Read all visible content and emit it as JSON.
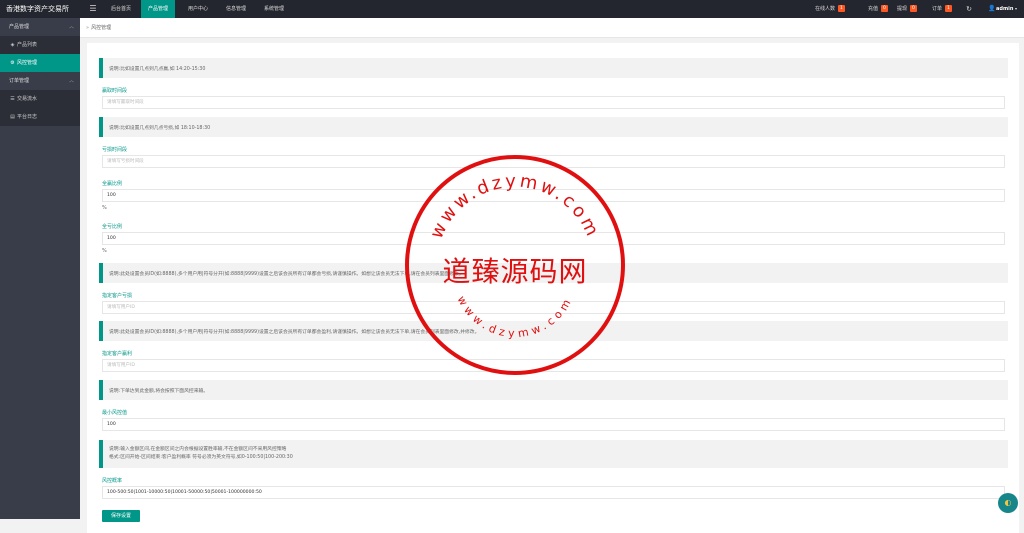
{
  "app": {
    "title": "香港数字资产交易所"
  },
  "topnav": [
    "后台首页",
    "产品管理",
    "用户中心",
    "信息管理",
    "系统管理"
  ],
  "status": [
    {
      "label": "在线人数",
      "count": "1"
    },
    {
      "label": "充值",
      "count": "0"
    },
    {
      "label": "提现",
      "count": "0"
    },
    {
      "label": "订单",
      "count": "1"
    }
  ],
  "user": {
    "name": "admin"
  },
  "sidebar": {
    "group1": "产品管理",
    "group1_items": [
      "产品列表",
      "风控管理"
    ],
    "group2": "订单管理",
    "group2_items": [
      "交易流水",
      "平台日志"
    ]
  },
  "breadcrumb": "风控管理",
  "form": {
    "note1": "说明:比如设置几点到几点赢,如 14:20-15:30",
    "label1": "赢取时间段",
    "placeholder1": "请填写赢取时间段",
    "note2": "说明:比如设置几点到几点亏损,如 18:10-18:30",
    "label2": "亏损时间段",
    "placeholder2": "请填写亏损时间段",
    "label3": "全赢比例",
    "value3": "100",
    "pct3": "%",
    "label4": "全亏比例",
    "value4": "100",
    "pct4": "%",
    "note5": "说明:此处设置会员ID(如:8888),多个用户用|符号分开(如:8888|9999)设置之后该会员所有订单都会亏损,请谨慎操作。如想让该会员无法下单,请在会员列表里面修改。",
    "label5": "指定客户亏损",
    "placeholder5": "请填写用户ID",
    "note6": "说明:此处设置会员ID(如:8888),多个用户用|符号分开(如:8888|9999)设置之后该会员所有订单都会盈利,请谨慎操作。如想让该会员无法下单,请在会员列表里面修改,并修改。",
    "label6": "指定客户赢利",
    "placeholder6": "请填写用户ID",
    "note7": "说明:下单达到此金额,将会按照下面风控来输。",
    "label7": "最小风控值",
    "value7": "100",
    "note8_line1": "说明:输入金额区间,在金额区间之内会根据设置胜率输,不在金额区间不采用风控策略",
    "note8_line2": "格式:区间开始-区间结束:客户盈利概率      符号必须为英文符号,如0-100:50|100-200:30",
    "label8": "风控概率",
    "value8": "100-500:50|1001-10000:50|10001-50000:50|50001-100000000:50",
    "save": "保存设置"
  },
  "watermark": {
    "main": "道臻源码网",
    "arc_top": "www.dzymw.com",
    "arc_bottom": "www.dzymw.com"
  },
  "colors": {
    "accent": "#009688",
    "topbar": "#23262e",
    "sidebar": "#393d49",
    "badge": "#ff5722",
    "stamp": "#e01010"
  }
}
